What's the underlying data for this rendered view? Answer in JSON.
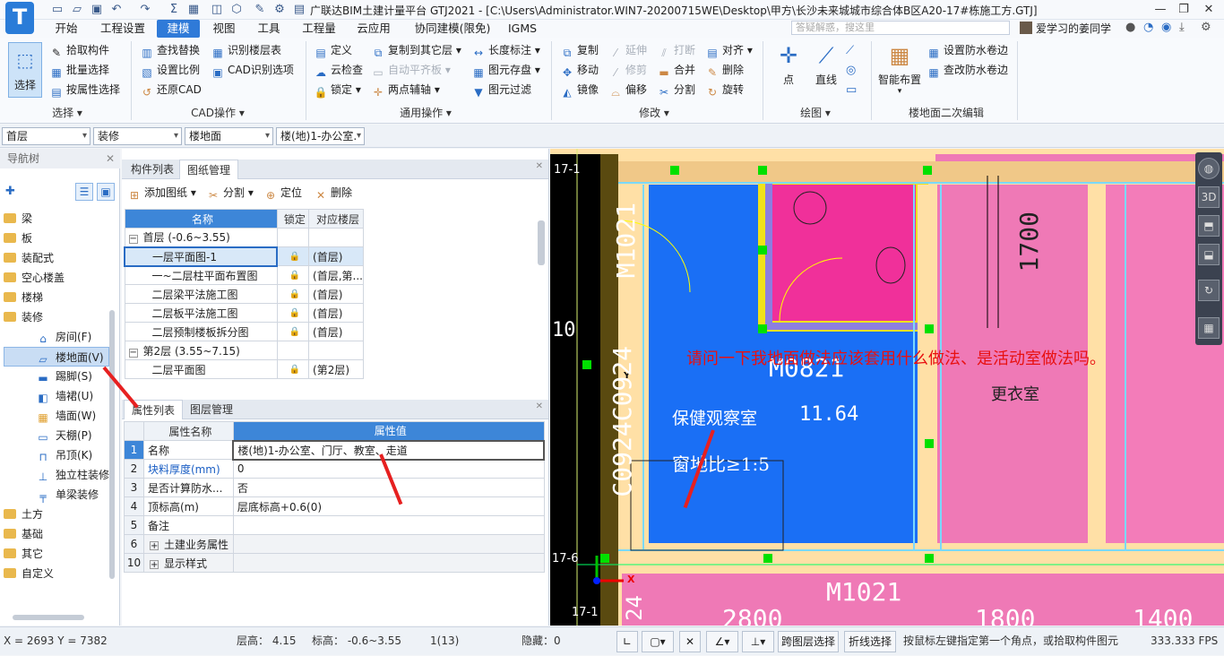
{
  "titlebar": {
    "logo": "T",
    "title": "广联达BIM土建计量平台 GTJ2021 - [C:\\Users\\Administrator.WIN7-20200715WE\\Desktop\\甲方\\长沙未来城城市综合体B区A20-17#栋施工方.GTJ]",
    "minimize": "—",
    "restore": "❐",
    "close": "✕"
  },
  "menubar": {
    "items": [
      "开始",
      "工程设置",
      "建模",
      "视图",
      "工具",
      "工程量",
      "云应用",
      "协同建模(限免)",
      "IGMS"
    ],
    "active": "建模",
    "search_placeholder": "答疑解惑，搜这里",
    "user": "爱学习的姜同学"
  },
  "ribbon": {
    "select": {
      "button": "选择",
      "group": "选择",
      "items": [
        "拾取构件",
        "批量选择",
        "按属性选择"
      ]
    },
    "cad": {
      "group": "CAD操作",
      "items": [
        "查找替换",
        "识别楼层表",
        "设置比例",
        "CAD识别选项",
        "还原CAD"
      ]
    },
    "general": {
      "group": "通用操作",
      "items": [
        "定义",
        "复制到其它层",
        "长度标注",
        "云检查",
        "自动平齐板",
        "图元存盘",
        "锁定",
        "两点辅轴",
        "图元过滤"
      ]
    },
    "modify": {
      "group": "修改",
      "items": [
        "复制",
        "延伸",
        "打断",
        "对齐",
        "移动",
        "修剪",
        "合并",
        "删除",
        "镜像",
        "偏移",
        "分割",
        "旋转"
      ]
    },
    "draw": {
      "group": "绘图",
      "items": [
        "点",
        "直线"
      ]
    },
    "floor2": {
      "group": "楼地面二次编辑",
      "items": [
        "智能布置",
        "设置防水卷边",
        "查改防水卷边"
      ]
    }
  },
  "filterbar": {
    "combos": [
      "首层",
      "装修",
      "楼地面",
      "楼(地)1-办公室."
    ]
  },
  "nav": {
    "title": "导航树",
    "folders": [
      "梁",
      "板",
      "装配式",
      "空心楼盖",
      "楼梯",
      "装修"
    ],
    "sub": [
      "房间(F)",
      "楼地面(V)",
      "踢脚(S)",
      "墙裙(U)",
      "墙面(W)",
      "天棚(P)",
      "吊顶(K)",
      "独立柱装修",
      "单梁装修"
    ],
    "folders_after": [
      "土方",
      "基础",
      "其它",
      "自定义"
    ],
    "selected": "楼地面(V)"
  },
  "drawing": {
    "tabs": [
      "构件列表",
      "图纸管理"
    ],
    "toolbar": [
      "添加图纸",
      "分割",
      "定位",
      "删除"
    ],
    "headers": [
      "名称",
      "锁定",
      "对应楼层"
    ],
    "rows": [
      {
        "name": "首层 (-0.6~3.55)",
        "lock": "",
        "floor": "",
        "group": true
      },
      {
        "name": "一层平面图-1",
        "lock": "🔒",
        "floor": "(首层)",
        "group": false
      },
      {
        "name": "一~二层柱平面布置图",
        "lock": "🔒",
        "floor": "(首层,第...",
        "group": false
      },
      {
        "name": "二层梁平法施工图",
        "lock": "🔒",
        "floor": "(首层)",
        "group": false
      },
      {
        "name": "二层板平法施工图",
        "lock": "🔒",
        "floor": "(首层)",
        "group": false
      },
      {
        "name": "二层预制楼板拆分图",
        "lock": "🔒",
        "floor": "(首层)",
        "group": false
      },
      {
        "name": "第2层 (3.55~7.15)",
        "lock": "",
        "floor": "",
        "group": true
      },
      {
        "name": "二层平面图",
        "lock": "🔒",
        "floor": "(第2层)",
        "group": false
      }
    ]
  },
  "props": {
    "tabs": [
      "属性列表",
      "图层管理"
    ],
    "headers": [
      "属性名称",
      "属性值"
    ],
    "rows": [
      {
        "no": "1",
        "name": "名称",
        "value": "楼(地)1-办公室、门厅、教室、走道",
        "blue": false
      },
      {
        "no": "2",
        "name": "块料厚度(mm)",
        "value": "0",
        "blue": true
      },
      {
        "no": "3",
        "name": "是否计算防水...",
        "value": "否",
        "blue": false
      },
      {
        "no": "4",
        "name": "顶标高(m)",
        "value": "层底标高+0.6(0)",
        "blue": false
      },
      {
        "no": "5",
        "name": "备注",
        "value": "",
        "blue": false
      },
      {
        "no": "6",
        "name": "土建业务属性",
        "value": "",
        "blue": false
      },
      {
        "no": "10",
        "name": "显示样式",
        "value": "",
        "blue": false
      }
    ]
  },
  "canvas": {
    "question": "请问一下我地面做法应该套用什么做法、是活动室做法吗。",
    "labels": [
      "M1021",
      "C0924C0924",
      "M0821",
      "保健观察室",
      "11.64",
      "窗地比≥1:5",
      "更衣室",
      "1700",
      "M1021",
      "17-1",
      "17-1",
      "17-6",
      "10",
      "2800",
      "1800",
      "1400",
      "24"
    ]
  },
  "statusbar": {
    "coords": "X = 2693 Y = 7382",
    "floor_height": "层高： 4.15",
    "elevation": "标高： -0.6~3.55",
    "count": "1(13)",
    "hidden": "隐藏：0",
    "btn1": "跨图层选择",
    "btn2": "折线选择",
    "hint": "按鼠标左键指定第一个角点，或拾取构件图元",
    "fps": "333.333 FPS"
  }
}
